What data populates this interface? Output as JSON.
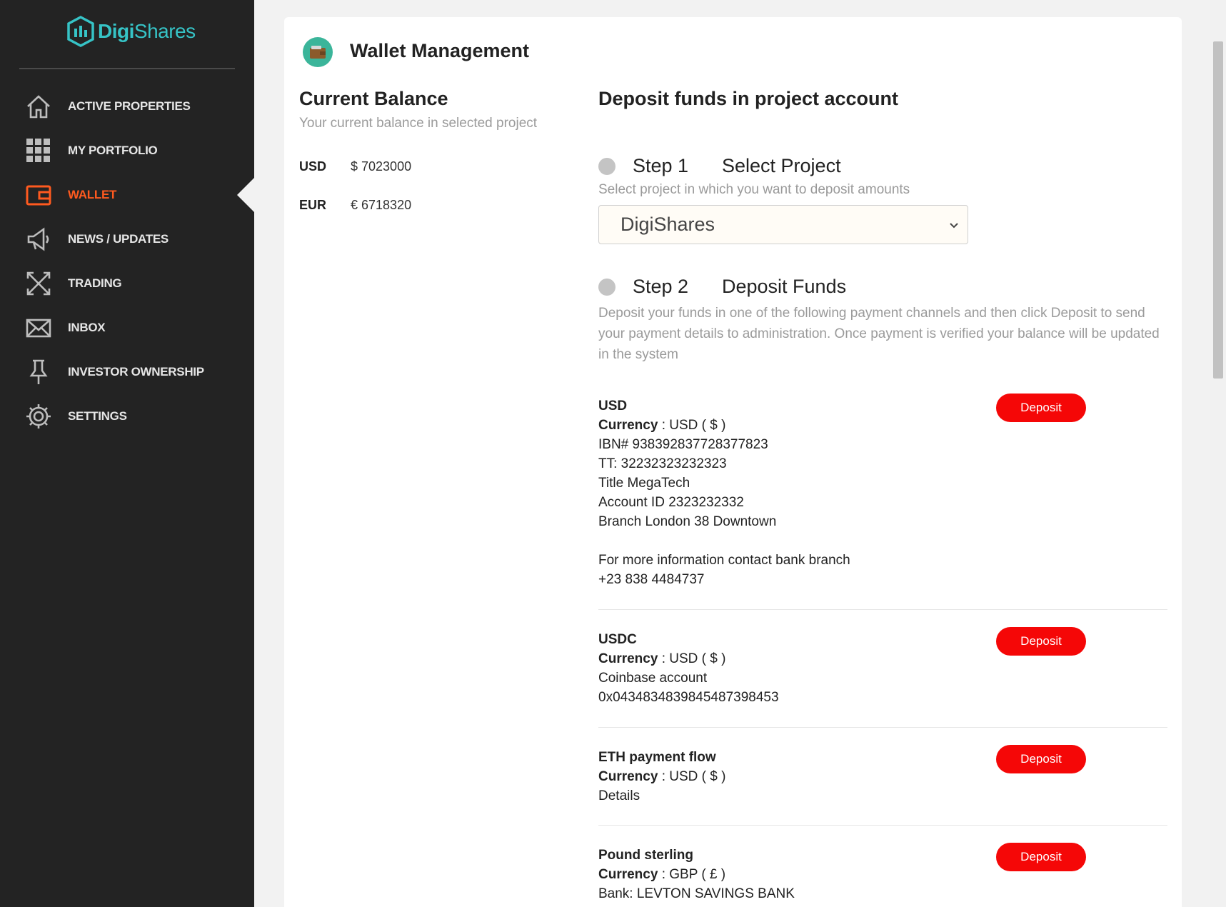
{
  "brand": {
    "bold": "Digi",
    "light": "Shares"
  },
  "colors": {
    "accent": "#ff5a1f",
    "deposit": "#f50707",
    "teal": "#36c3c6",
    "sidebar": "#232323"
  },
  "nav": [
    {
      "label": "ACTIVE PROPERTIES",
      "icon": "home-icon",
      "active": false
    },
    {
      "label": "MY PORTFOLIO",
      "icon": "grid-icon",
      "active": false
    },
    {
      "label": "WALLET",
      "icon": "wallet-icon",
      "active": true
    },
    {
      "label": "NEWS / UPDATES",
      "icon": "megaphone-icon",
      "active": false
    },
    {
      "label": "TRADING",
      "icon": "arrows-icon",
      "active": false
    },
    {
      "label": "INBOX",
      "icon": "envelope-icon",
      "active": false
    },
    {
      "label": "INVESTOR OWNERSHIP",
      "icon": "pin-icon",
      "active": false
    },
    {
      "label": "SETTINGS",
      "icon": "gear-icon",
      "active": false
    }
  ],
  "page": {
    "title": "Wallet Management"
  },
  "balance": {
    "title": "Current Balance",
    "subtitle": "Your current balance in selected project",
    "rows": [
      {
        "currency": "USD",
        "value": "$ 7023000"
      },
      {
        "currency": "EUR",
        "value": "€ 6718320"
      }
    ]
  },
  "deposit": {
    "title": "Deposit funds in project account",
    "step1": {
      "num": "Step 1",
      "name": "Select Project",
      "desc": "Select project in which you want to deposit amounts",
      "selected": "DigiShares"
    },
    "step2": {
      "num": "Step 2",
      "name": "Deposit Funds",
      "desc": "Deposit your funds in one of the following payment channels and then click Deposit to send your payment details to administration. Once payment is verified your balance will be updated in the system"
    },
    "button_label": "Deposit",
    "currency_label": "Currency",
    "channels": [
      {
        "name": "USD",
        "currency": " : USD ( $ )",
        "lines": [
          "IBN# 938392837728377823",
          "TT: 32232323232323",
          "Title MegaTech",
          "Account ID 2323232332",
          "Branch London 38 Downtown"
        ],
        "extra": [
          "For more information contact bank branch",
          "+23 838 4484737"
        ]
      },
      {
        "name": "USDC",
        "currency": " : USD ( $ )",
        "lines": [
          "Coinbase account",
          "0x043483483984548739845​3"
        ]
      },
      {
        "name": "ETH payment flow",
        "currency": " : USD ( $ )",
        "lines": [
          "Details"
        ]
      },
      {
        "name": "Pound sterling",
        "currency": " : GBP ( £ )",
        "lines": [
          "Bank: LEVTON SAVINGS BANK"
        ]
      }
    ]
  }
}
